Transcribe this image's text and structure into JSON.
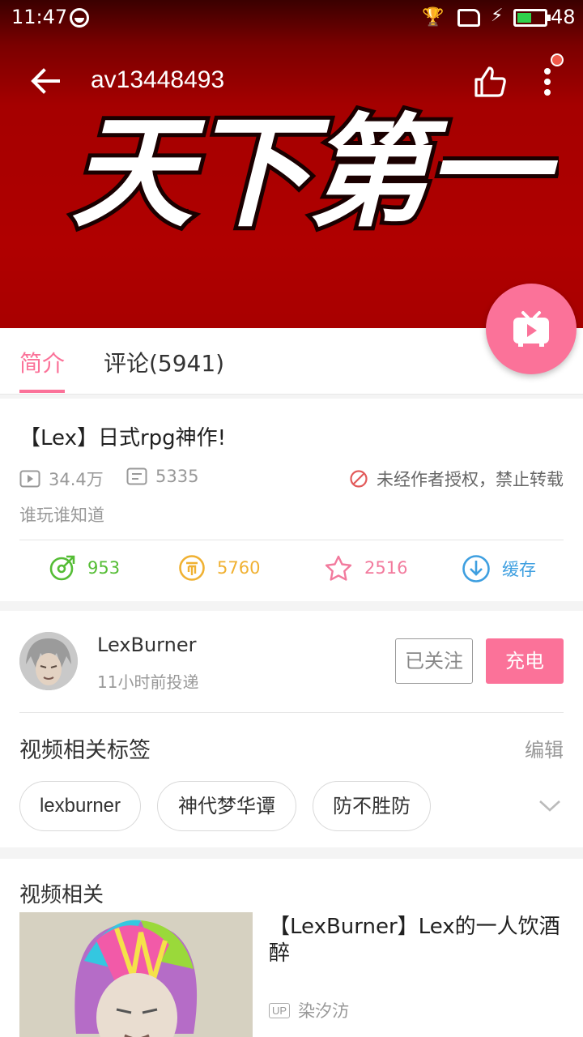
{
  "status_bar": {
    "time": "11:47",
    "battery_level": "48"
  },
  "header": {
    "video_id": "av13448493",
    "cover_text": "天下第一"
  },
  "tabs": [
    {
      "label": "简介",
      "active": true
    },
    {
      "label": "评论(5941)",
      "active": false
    }
  ],
  "video": {
    "title": "【Lex】日式rpg神作!",
    "views": "34.4万",
    "danmaku": "5335",
    "copyright_notice": "未经作者授权，禁止转载",
    "description": "谁玩谁知道",
    "actions": {
      "share": "953",
      "coin": "5760",
      "favorite": "2516",
      "cache": "缓存"
    }
  },
  "uploader": {
    "name": "LexBurner",
    "posted_time": "11小时前投递",
    "follow_label": "已关注",
    "charge_label": "充电"
  },
  "tags_section": {
    "heading": "视频相关标签",
    "edit_label": "编辑",
    "tags": [
      "lexburner",
      "神代梦华谭",
      "防不胜防"
    ]
  },
  "related": {
    "heading": "视频相关",
    "items": [
      {
        "title": "【LexBurner】Lex的一人饮酒醉",
        "uploader": "染汐汸"
      }
    ]
  },
  "colors": {
    "accent": "#fb7299",
    "share": "#55bd35",
    "coin": "#f0b132",
    "favorite": "#f27a9d",
    "cache": "#3e9fe0",
    "banner": "#b00000"
  },
  "icons": [
    "back-arrow-icon",
    "thumbs-up-icon",
    "more-vertical-icon",
    "tv-play-icon",
    "play-count-icon",
    "danmaku-icon",
    "no-repost-icon",
    "share-icon",
    "coin-icon",
    "star-icon",
    "download-icon",
    "chevron-down-icon"
  ]
}
